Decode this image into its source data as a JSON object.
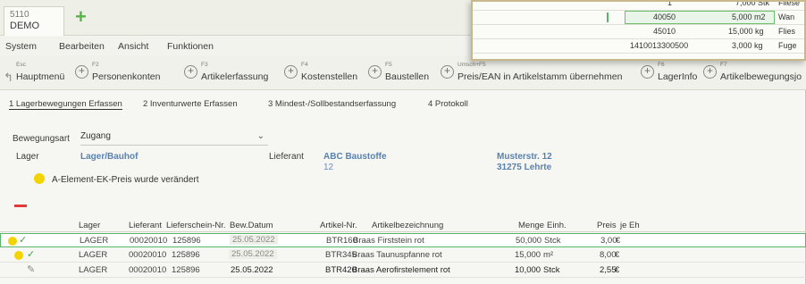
{
  "tab": {
    "code": "5110",
    "name": "DEMO"
  },
  "menu": [
    "System",
    "Bearbeiten",
    "Ansicht",
    "Funktionen"
  ],
  "toolbar": [
    {
      "key": "Esc",
      "label": "Hauptmenü"
    },
    {
      "key": "F2",
      "label": "Personenkonten"
    },
    {
      "key": "F3",
      "label": "Artikelerfassung"
    },
    {
      "key": "F4",
      "label": "Kostenstellen"
    },
    {
      "key": "F5",
      "label": "Baustellen"
    },
    {
      "key": "Umsch+F5",
      "label": "Preis/EAN in Artikelstamm übernehmen"
    },
    {
      "key": "F6",
      "label": "LagerInfo"
    },
    {
      "key": "F7",
      "label": "Artikelbewegungsjo"
    }
  ],
  "page_tabs": [
    "1 Lagerbewegungen Erfassen",
    "2 Inventurwerte Erfassen",
    "3 Mindest-/Sollbestandserfassung",
    "4 Protokoll"
  ],
  "form": {
    "movement_label": "Bewegungsart",
    "movement_value": "Zugang",
    "lager_label": "Lager",
    "lager_head": "Lager/Bauhof",
    "lieferant_label": "Lieferant",
    "lieferant_name": "ABC Baustoffe",
    "lieferant_nr": "12",
    "address_street": "Musterstr. 12",
    "address_city": "31275 Lehrte",
    "warning": "A-Element-EK-Preis wurde verändert"
  },
  "grid": {
    "headers": [
      "Lager",
      "Lieferant",
      "Lieferschein-Nr.",
      "Bew.Datum",
      "Artikel-Nr.",
      "Artikelbezeichnung",
      "Menge",
      "Einh.",
      "Preis",
      "je Eh"
    ],
    "rows": [
      {
        "lager": "LAGER",
        "lieferant": "00020010",
        "lieferschein": "125896",
        "datum": "25.05.2022",
        "artikel": "BTR160",
        "bez": "Braas Firststein rot",
        "menge": "50,000",
        "einh": "Stck",
        "preis": "3,00",
        "je": "€"
      },
      {
        "lager": "LAGER",
        "lieferant": "00020010",
        "lieferschein": "125896",
        "datum": "25.05.2022",
        "artikel": "BTR345",
        "bez": "Braas Taunuspfanne rot",
        "menge": "15,000",
        "einh": "m²",
        "preis": "8,00",
        "je": "€"
      },
      {
        "lager": "LAGER",
        "lieferant": "00020010",
        "lieferschein": "125896",
        "datum": "25.05.2022",
        "artikel": "BTR420",
        "bez": "Braas Aerofirstelement rot",
        "menge": "10,000",
        "einh": "Stck",
        "preis": "2,55",
        "je": "€"
      }
    ]
  },
  "overlay": {
    "rows": [
      {
        "a": "1",
        "b": "7,000 Stk",
        "c": "Fliese"
      },
      {
        "a": "40050",
        "b": "5,000 m2",
        "c": "Wan"
      },
      {
        "a": "45010",
        "b": "15,000 kg",
        "c": "Flies"
      },
      {
        "a": "1410013300500",
        "b": "3,000 kg",
        "c": "Fuge"
      }
    ]
  },
  "colors": {
    "accent_green": "#58b548",
    "warning_yellow": "#f3d400",
    "label_blue": "#5a82b0",
    "remove_red": "#e03a3a"
  }
}
